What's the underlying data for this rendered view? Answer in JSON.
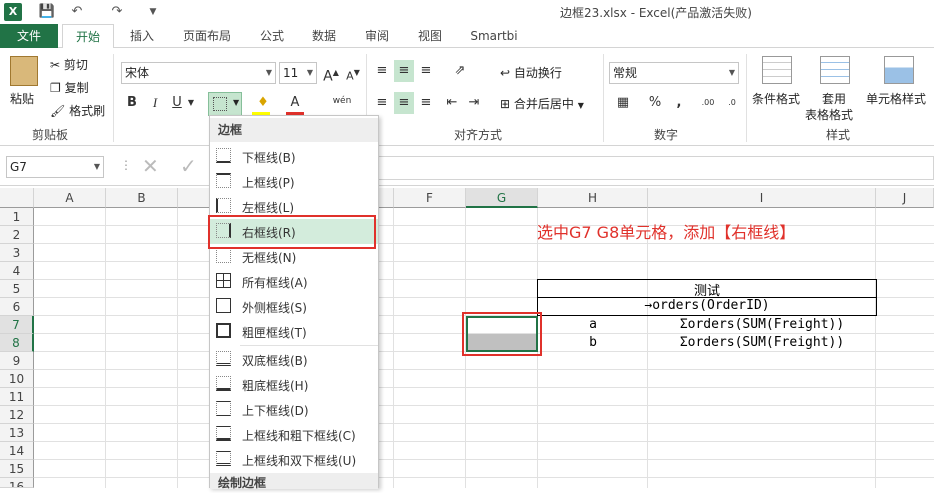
{
  "titlebar": {
    "title": "边框23.xlsx - Excel(产品激活失败)",
    "app_icon": "X",
    "icons": [
      "excel-logo-icon",
      "save-icon",
      "undo-icon",
      "redo-icon",
      "customize-icon"
    ]
  },
  "tabs": [
    "文件",
    "开始",
    "插入",
    "页面布局",
    "公式",
    "数据",
    "审阅",
    "视图",
    "Smartbi"
  ],
  "ribbon": {
    "clipboard": {
      "paste": "粘贴",
      "cut": "剪切",
      "copy": "复制",
      "format_painter": "格式刷",
      "group": "剪贴板"
    },
    "font": {
      "name": "宋体",
      "size": "11",
      "bold": "B",
      "italic": "I",
      "underline": "U",
      "wen": "wén",
      "font_color": "A"
    },
    "align": {
      "wrap": "自动换行",
      "merge": "合并后居中",
      "group": "对齐方式"
    },
    "number": {
      "format": "常规",
      "percent": "%",
      "comma": ",",
      "inc_dec": ".00",
      "group": "数字",
      "inc": ".0",
      "dec_dec": ".00"
    },
    "styles": {
      "conditional": "条件格式",
      "table_fmt_1": "套用",
      "table_fmt_2": "表格格式",
      "cell_styles": "单元格样式",
      "group": "样式"
    }
  },
  "formula_bar": {
    "name_box": "G7"
  },
  "columns": [
    "A",
    "B",
    "C",
    "D",
    "E",
    "F",
    "G",
    "H",
    "I",
    "J"
  ],
  "rows": [
    "1",
    "2",
    "3",
    "4",
    "5",
    "6",
    "7",
    "8",
    "9",
    "10",
    "11",
    "12",
    "13",
    "14",
    "15",
    "16"
  ],
  "dropdown": {
    "header": "边框",
    "items": [
      "下框线(B)",
      "上框线(P)",
      "左框线(L)",
      "右框线(R)",
      "无框线(N)",
      "所有框线(A)",
      "外侧框线(S)",
      "粗匣框线(T)",
      "双底框线(B)",
      "粗底框线(H)",
      "上下框线(D)",
      "上框线和粗下框线(C)",
      "上框线和双下框线(U)"
    ],
    "footer": "绘制边框"
  },
  "annotation": "选中G7 G8单元格，添加【右框线】",
  "sheet": {
    "title_cell": "测试",
    "row6": "orders(OrderID)",
    "row7_h": "a",
    "row7_i": "Σorders(SUM(Freight))",
    "row8_h": "b",
    "row8_i": "Σorders(SUM(Freight))"
  }
}
